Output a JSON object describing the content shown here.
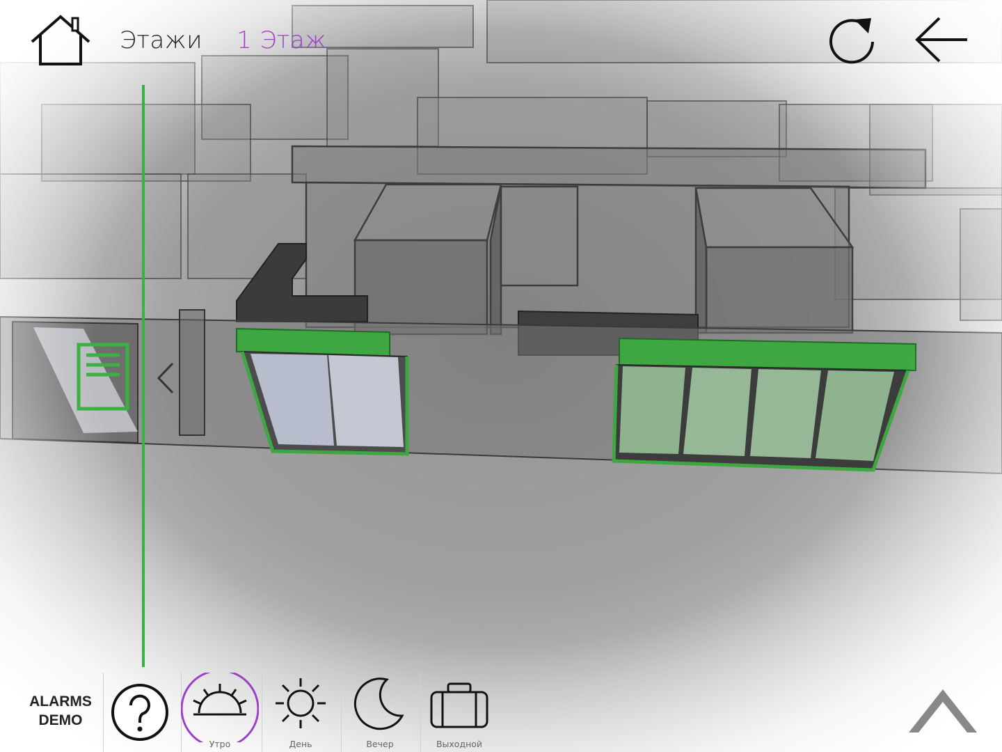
{
  "header": {
    "breadcrumb_floors": "Этажи",
    "breadcrumb_current": "1 Этаж"
  },
  "footer": {
    "app_label_line1": "ALARMS",
    "app_label_line2": "DEMO",
    "modes": [
      {
        "label": "Утро",
        "icon": "sunrise-icon",
        "selected": true
      },
      {
        "label": "День",
        "icon": "sun-icon",
        "selected": false
      },
      {
        "label": "Вечер",
        "icon": "moon-icon",
        "selected": false
      },
      {
        "label": "Выходной",
        "icon": "suitcase-icon",
        "selected": false
      }
    ]
  },
  "colors": {
    "accent_purple": "#9b3fc8",
    "highlight_green": "#3cb043",
    "wall_gray": "#6e6e6e"
  }
}
